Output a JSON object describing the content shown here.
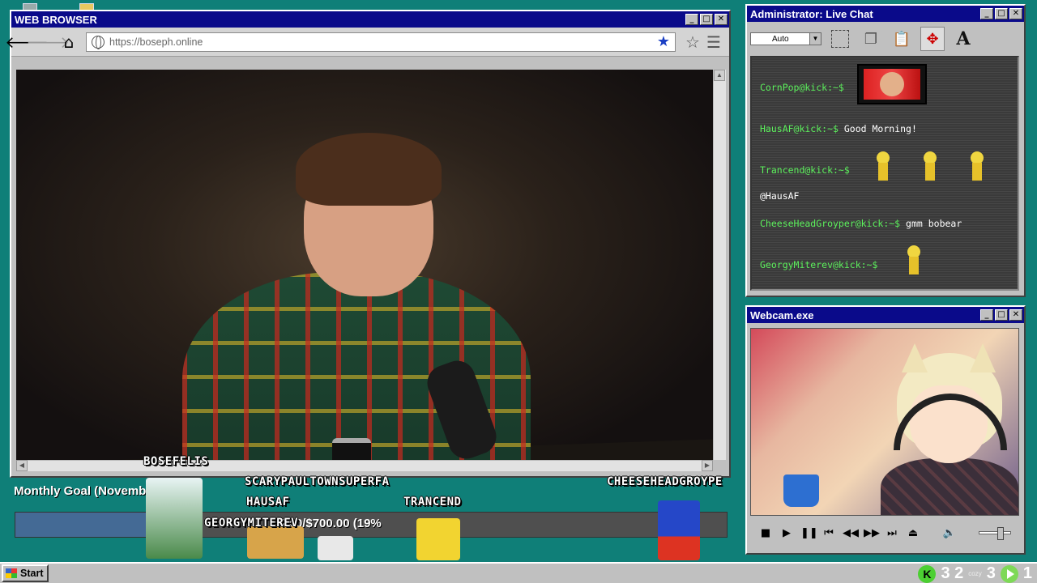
{
  "browser": {
    "title": "WEB BROWSER",
    "url": "https://boseph.online",
    "nav": {
      "back_icon": "arrow-left-icon",
      "forward_icon": "arrow-right-icon",
      "home_icon": "home-icon"
    }
  },
  "chat": {
    "title": "Administrator: Live Chat",
    "font_select": "Auto",
    "messages": [
      {
        "user": "CornPop@kick:~$",
        "text": ""
      },
      {
        "user": "HausAF@kick:~$",
        "text": "Good Morning!"
      },
      {
        "user": "Trancend@kick:~$",
        "text": ""
      },
      {
        "user": "",
        "text": "@HausAF"
      },
      {
        "user": "CheeseHeadGroyper@kick:~$",
        "text": "gmm bobear"
      },
      {
        "user": "GeorgyMiterev@kick:~$",
        "text": ""
      }
    ]
  },
  "webcam": {
    "title": "Webcam.exe"
  },
  "goal": {
    "title": "Monthly Goal (November)",
    "amount_text": "4.00/$700.00 (19%",
    "progress_percent": 19,
    "bar_color": "#446a95"
  },
  "overlay_names": {
    "bosefelis": "BOSEFELIS",
    "scarypaul": "SCARYPAULTOWNSUPERFA",
    "hausaf": "HAUSAF",
    "trancend": "TRANCEND",
    "cheesehead": "CHEESEHEADGROYPE",
    "georgy": "GEORGYMITEREV"
  },
  "taskbar": {
    "start_label": "Start",
    "tray_count_1": "3 2",
    "tray_cozy": "cozy",
    "tray_count_2": "3",
    "tray_count_3": "1"
  },
  "colors": {
    "desktop": "#0f7f78",
    "titlebar": "#0a0a8a",
    "chat_user": "#5cf05c"
  }
}
